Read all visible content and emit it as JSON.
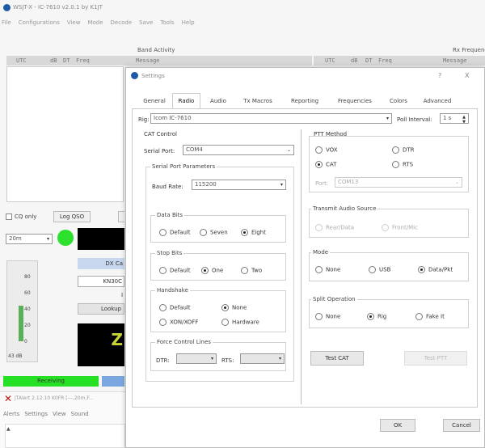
{
  "main": {
    "title": "WSJT-X - IC-7610  v2.0.1  by K1JT",
    "menu": [
      "File",
      "Configurations",
      "View",
      "Mode",
      "Decode",
      "Save",
      "Tools",
      "Help"
    ],
    "band_activity": "Band Activity",
    "rx_frequency": "Rx Frequenc",
    "col_headers": [
      "UTC",
      "dB",
      "DT",
      "Freq",
      "Message"
    ],
    "col_headers2": [
      "UTC",
      "dB",
      "DT",
      "Freq",
      "Message"
    ],
    "cq_only": "CQ only",
    "log_qso": "Log QSO",
    "band": "20m",
    "dx_call": "DX Ca",
    "grid": "KN30C",
    "lookup": "Lookup",
    "db_scale": [
      "80",
      "60",
      "40",
      "20",
      "0"
    ],
    "db_label": "43 dB",
    "receiving": "Receiving",
    "big_digit": "Z",
    "digit_i": "I"
  },
  "second_window": {
    "title": "JTAlert 2.12.10  K0FR [---,20m,F...",
    "menu": [
      "Alerts",
      "Settings",
      "View",
      "Sound"
    ]
  },
  "dialog": {
    "title": "Settings",
    "help": "?",
    "close": "X",
    "tabs": [
      "General",
      "Radio",
      "Audio",
      "Tx Macros",
      "Reporting",
      "Frequencies",
      "Colors",
      "Advanced"
    ],
    "rig_label": "Rig:",
    "rig_value": "Icom IC-7610",
    "poll_label": "Poll Interval:",
    "poll_value": "1 s",
    "cat_control": "CAT Control",
    "serial_port_label": "Serial Port:",
    "serial_port_value": "COM4",
    "serial_params": "Serial Port Parameters",
    "baud_label": "Baud Rate:",
    "baud_value": "115200",
    "data_bits": "Data Bits",
    "data_bits_opts": [
      "Default",
      "Seven",
      "Eight"
    ],
    "stop_bits": "Stop Bits",
    "stop_bits_opts": [
      "Default",
      "One",
      "Two"
    ],
    "handshake": "Handshake",
    "handshake_opts": [
      "Default",
      "None",
      "XON/XOFF",
      "Hardware"
    ],
    "force_lines": "Force Control Lines",
    "dtr_label": "DTR:",
    "rts_label": "RTS:",
    "ptt_method": "PTT Method",
    "ptt_opts": [
      "VOX",
      "DTR",
      "CAT",
      "RTS"
    ],
    "port_label": "Port:",
    "port_value": "COM13",
    "tx_audio": "Transmit Audio Source",
    "tx_audio_opts": [
      "Rear/Data",
      "Front/Mic"
    ],
    "mode": "Mode",
    "mode_opts": [
      "None",
      "USB",
      "Data/Pkt"
    ],
    "split": "Split Operation",
    "split_opts": [
      "None",
      "Rig",
      "Fake It"
    ],
    "test_cat": "Test CAT",
    "test_ptt": "Test PTT",
    "ok": "OK",
    "cancel": "Cancel"
  }
}
